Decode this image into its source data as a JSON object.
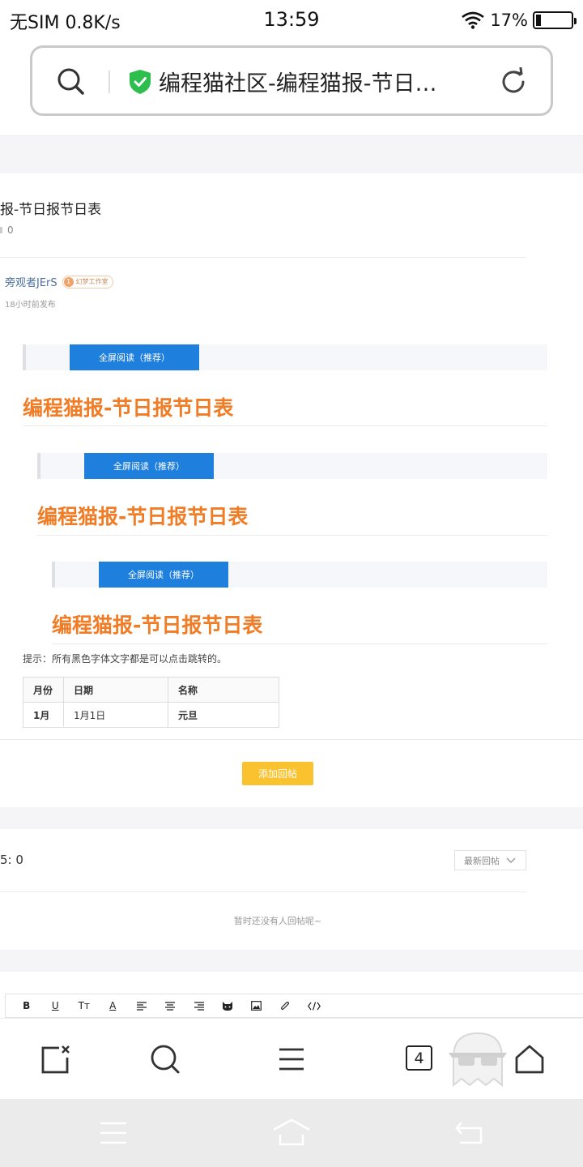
{
  "status_bar": {
    "carrier": "无SIM",
    "speed": "0.8K/s",
    "time": "13:59",
    "battery": "17%"
  },
  "address_bar": {
    "title": "编程猫社区-编程猫报-节日…"
  },
  "post": {
    "title_partial": "报-节日报节日表",
    "stat_count": "0",
    "author": "旁观者JErS",
    "badge_level": "1",
    "badge_text": "幻梦工作室",
    "time": "18小时前发布"
  },
  "blocks": [
    {
      "read_label": "全屏阅读（推荐）",
      "heading": "编程猫报-节日报节日表"
    },
    {
      "read_label": "全屏阅读（推荐）",
      "heading": "编程猫报-节日报节日表"
    },
    {
      "read_label": "全屏阅读（推荐）",
      "heading": "编程猫报-节日报节日表"
    }
  ],
  "hint": "提示：所有黑色字体文字都是可以点击跳转的。",
  "table": {
    "headers": [
      "月份",
      "日期",
      "名称"
    ],
    "rows": [
      [
        "1月",
        "1月1日",
        "元旦"
      ]
    ]
  },
  "reply_button": "添加回帖",
  "replies": {
    "count_partial": "5: 0",
    "sort": "最新回帖",
    "empty": "暂时还没有人回帖呢~"
  },
  "editor_toolbar": {
    "bold": "B",
    "underline": "U",
    "text_size": "Tт",
    "font_color": "A"
  },
  "browser_bar": {
    "tab_count": "4"
  },
  "colors": {
    "accent_blue": "#1e7fdd",
    "heading_orange": "#f07c25",
    "reply_yellow": "#f9c22e",
    "shield_green": "#2dbe4e"
  }
}
